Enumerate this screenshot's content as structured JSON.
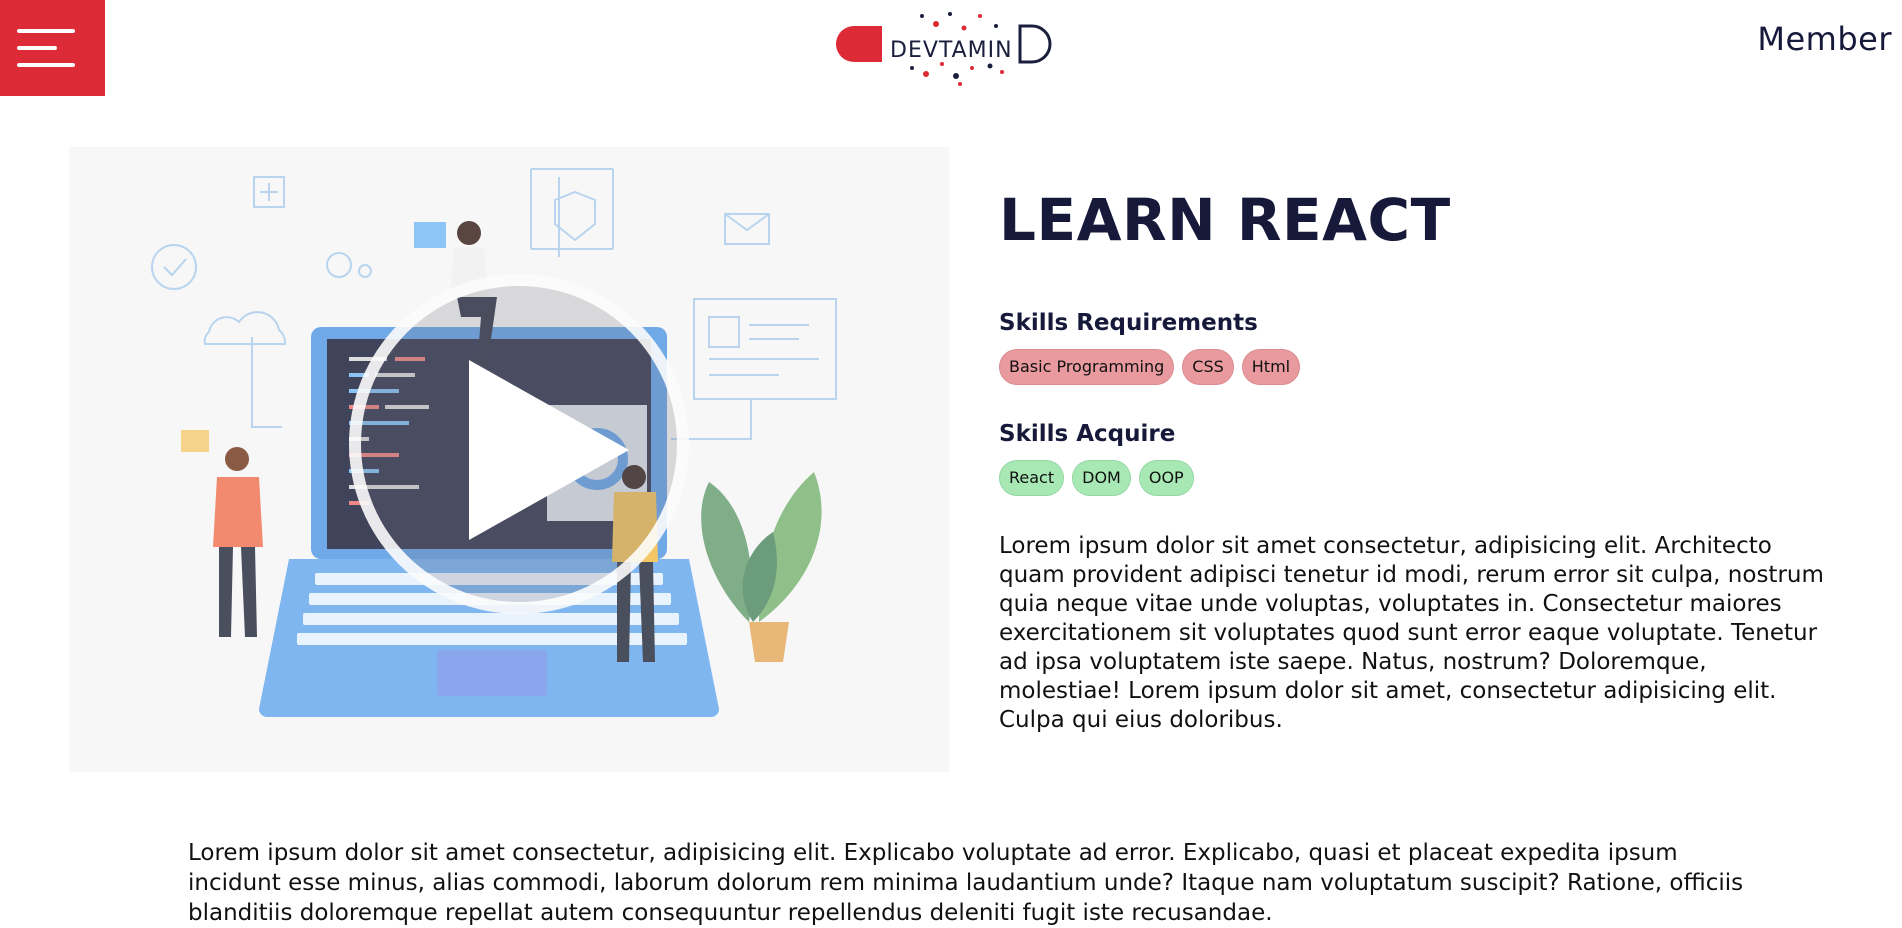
{
  "header": {
    "menu_icon": "hamburger-icon",
    "logo_text": "DEVTAMIN",
    "member_label": "Member",
    "accent_color": "#dc2b36"
  },
  "video": {
    "play_icon": "play-icon"
  },
  "course": {
    "title": "LEARN REACT",
    "requirements_title": "Skills Requirements",
    "requirements": [
      "Basic Programming",
      "CSS",
      "Html"
    ],
    "acquire_title": "Skills Acquire",
    "acquire": [
      "React",
      "DOM",
      "OOP"
    ],
    "description": "Lorem ipsum dolor sit amet consectetur, adipisicing elit. Architecto quam provident adipisci tenetur id modi, rerum error sit culpa, nostrum quia neque vitae unde voluptas, voluptates in. Consectetur maiores exercitationem sit voluptates quod sunt error eaque voluptate. Tenetur ad ipsa voluptatem iste saepe. Natus, nostrum? Doloremque, molestiae! Lorem ipsum dolor sit amet, consectetur adipisicing elit. Culpa qui eius doloribus."
  },
  "body": {
    "text": "Lorem ipsum dolor sit amet consectetur, adipisicing elit. Explicabo voluptate ad error. Explicabo, quasi et placeat expedita ipsum incidunt esse minus, alias commodi, laborum dolorum rem minima laudantium unde? Itaque nam voluptatum suscipit? Ratione, officiis blanditiis doloremque repellat autem consequuntur repellendus deleniti fugit iste recusandae."
  }
}
